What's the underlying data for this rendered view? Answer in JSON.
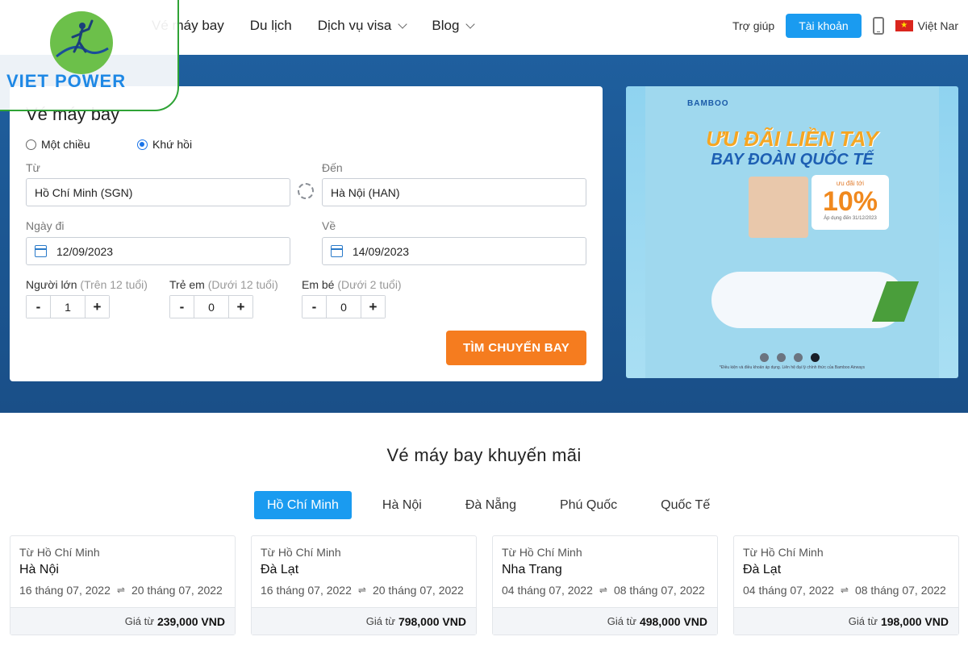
{
  "header": {
    "logo_text": "VIET POWER",
    "nav": [
      {
        "label": "Vé máy bay"
      },
      {
        "label": "Du lịch"
      },
      {
        "label": "Dịch vụ visa"
      },
      {
        "label": "Blog"
      }
    ],
    "help_label": "Trợ giúp",
    "account_label": "Tài khoản",
    "language_label": "Việt Nar",
    "flag_star": "★"
  },
  "search": {
    "title": "Vé máy bay",
    "trip_types": [
      {
        "label": "Một chiều",
        "selected": false
      },
      {
        "label": "Khứ hồi",
        "selected": true
      }
    ],
    "from_label": "Từ",
    "from_value": "Hồ Chí Minh (SGN)",
    "to_label": "Đến",
    "to_value": "Hà Nội (HAN)",
    "depart_label": "Ngày đi",
    "depart_value": "12/09/2023",
    "return_label": "Về",
    "return_value": "14/09/2023",
    "passengers": [
      {
        "label": "Người lớn",
        "hint": "(Trên 12 tuổi)",
        "count": "1"
      },
      {
        "label": "Trẻ em",
        "hint": "(Dưới 12 tuổi)",
        "count": "0"
      },
      {
        "label": "Em bé",
        "hint": "(Dưới 2 tuổi)",
        "count": "0"
      }
    ],
    "minus": "-",
    "plus": "+",
    "submit_label": "TÌM CHUYẾN BAY"
  },
  "banner": {
    "brand": "BAMBOO",
    "headline_1": "ƯU ĐÃI LIỀN TAY",
    "headline_2": "BAY ĐOÀN QUỐC TẾ",
    "promo_small": "ưu đãi tới",
    "promo_value": "10%",
    "promo_apply": "Áp dụng đến 31/12/2023",
    "note": "*Điều kiện và điều khoản áp dụng. Liên hệ đại lý chính thức của Bamboo Airways",
    "slides": 4,
    "active_slide": 4
  },
  "promotions": {
    "title": "Vé máy bay khuyến mãi",
    "tabs": [
      {
        "label": "Hồ Chí Minh",
        "active": true
      },
      {
        "label": "Hà Nội",
        "active": false
      },
      {
        "label": "Đà Nẵng",
        "active": false
      },
      {
        "label": "Phú Quốc",
        "active": false
      },
      {
        "label": "Quốc Tế",
        "active": false
      }
    ],
    "price_prefix": "Giá từ",
    "swap_glyph": "⇌",
    "deals": [
      {
        "from": "Từ Hồ Chí Minh",
        "to": "Hà Nội",
        "depart": "16 tháng 07, 2022",
        "return": "20 tháng 07, 2022",
        "price": "239,000 VND"
      },
      {
        "from": "Từ Hồ Chí Minh",
        "to": "Đà Lạt",
        "depart": "16 tháng 07, 2022",
        "return": "20 tháng 07, 2022",
        "price": "798,000 VND"
      },
      {
        "from": "Từ Hồ Chí Minh",
        "to": "Nha Trang",
        "depart": "04 tháng 07, 2022",
        "return": "08 tháng 07, 2022",
        "price": "498,000 VND"
      },
      {
        "from": "Từ Hồ Chí Minh",
        "to": "Đà Lạt",
        "depart": "04 tháng 07, 2022",
        "return": "08 tháng 07, 2022",
        "price": "198,000 VND"
      }
    ]
  },
  "colors": {
    "accent": "#1a9bf0",
    "cta": "#f57c1f",
    "hero_bg": "#1b5590"
  }
}
